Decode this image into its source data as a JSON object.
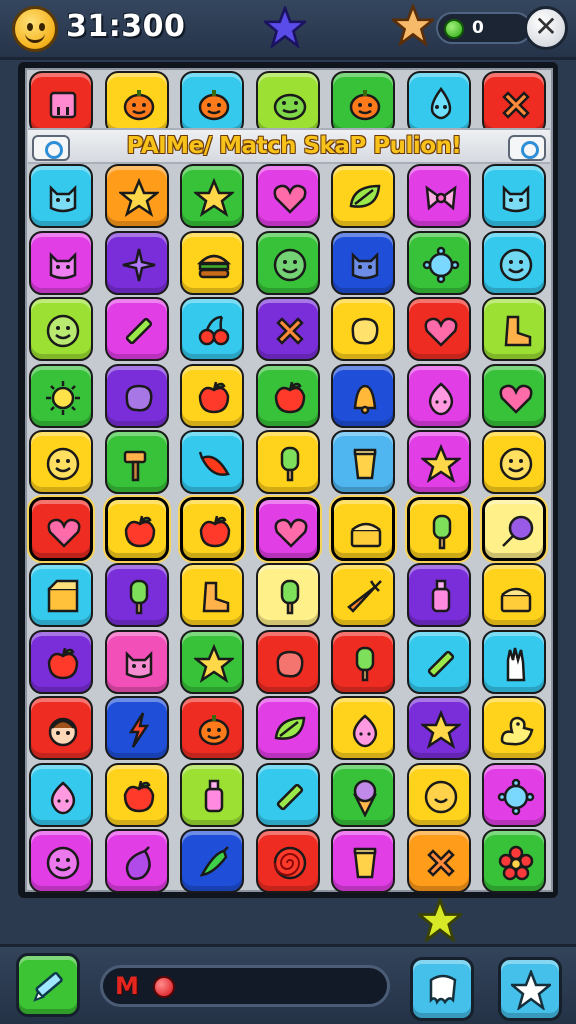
{
  "hud": {
    "score": "31:300",
    "coins": "0",
    "close_symbol": "✕"
  },
  "banner": {
    "title": "PAIMe/ Match SkaP Pulion!"
  },
  "progress": {
    "label": "M",
    "fraction": 0.0
  },
  "colors": {
    "red": "#ee2c22",
    "yellow": "#ffd21c",
    "cyan": "#35c9ee",
    "lime": "#9be033",
    "green": "#38c23a",
    "magenta": "#e23ee6",
    "purple": "#7a2ed9",
    "orange": "#ff9c1a",
    "blue": "#1f4fd8",
    "sky": "#4fb6f0",
    "pink": "#f24fb8",
    "paleyellow": "#fff08a"
  },
  "board": {
    "columns": 7,
    "rows": [
      [
        {
          "c": "red",
          "i": "robot"
        },
        {
          "c": "yellow",
          "i": "pumpkin"
        },
        {
          "c": "cyan",
          "i": "pumpkin"
        },
        {
          "c": "lime",
          "i": "frog"
        },
        {
          "c": "green",
          "i": "pumpkin"
        },
        {
          "c": "cyan",
          "i": "drop"
        },
        {
          "c": "red",
          "i": "x-cross"
        }
      ],
      [
        {
          "c": "cyan",
          "i": "cat"
        },
        {
          "c": "orange",
          "i": "star"
        },
        {
          "c": "green",
          "i": "star"
        },
        {
          "c": "magenta",
          "i": "heart"
        },
        {
          "c": "yellow",
          "i": "leaf"
        },
        {
          "c": "magenta",
          "i": "bow"
        },
        {
          "c": "cyan",
          "i": "cat"
        }
      ],
      [
        {
          "c": "magenta",
          "i": "cat"
        },
        {
          "c": "purple",
          "i": "sparkle"
        },
        {
          "c": "yellow",
          "i": "burger"
        },
        {
          "c": "green",
          "i": "smiley"
        },
        {
          "c": "blue",
          "i": "cat"
        },
        {
          "c": "green",
          "i": "germ"
        },
        {
          "c": "cyan",
          "i": "smiley"
        }
      ],
      [
        {
          "c": "lime",
          "i": "smiley"
        },
        {
          "c": "magenta",
          "i": "pencil"
        },
        {
          "c": "cyan",
          "i": "cherry"
        },
        {
          "c": "purple",
          "i": "x-cross"
        },
        {
          "c": "yellow",
          "i": "blob"
        },
        {
          "c": "red",
          "i": "heart"
        },
        {
          "c": "lime",
          "i": "boot"
        }
      ],
      [
        {
          "c": "green",
          "i": "sun"
        },
        {
          "c": "purple",
          "i": "blob"
        },
        {
          "c": "yellow",
          "i": "apple"
        },
        {
          "c": "green",
          "i": "apple"
        },
        {
          "c": "blue",
          "i": "bell"
        },
        {
          "c": "magenta",
          "i": "onion"
        },
        {
          "c": "green",
          "i": "heart"
        }
      ],
      [
        {
          "c": "yellow",
          "i": "smiley"
        },
        {
          "c": "green",
          "i": "hammer"
        },
        {
          "c": "cyan",
          "i": "chili"
        },
        {
          "c": "yellow",
          "i": "popsicle"
        },
        {
          "c": "sky",
          "i": "cup"
        },
        {
          "c": "magenta",
          "i": "star"
        },
        {
          "c": "yellow",
          "i": "smiley"
        }
      ],
      [
        {
          "c": "red",
          "i": "heart",
          "h": true
        },
        {
          "c": "yellow",
          "i": "apple",
          "h": true
        },
        {
          "c": "yellow",
          "i": "apple",
          "h": true
        },
        {
          "c": "magenta",
          "i": "heart",
          "h": true
        },
        {
          "c": "yellow",
          "i": "cake",
          "h": true
        },
        {
          "c": "yellow",
          "i": "popsicle",
          "h": true
        },
        {
          "c": "paleyellow",
          "i": "lollipop",
          "h": true
        }
      ],
      [
        {
          "c": "cyan",
          "i": "box"
        },
        {
          "c": "purple",
          "i": "popsicle"
        },
        {
          "c": "yellow",
          "i": "boot"
        },
        {
          "c": "paleyellow",
          "i": "popsicle"
        },
        {
          "c": "yellow",
          "i": "carrot"
        },
        {
          "c": "purple",
          "i": "bottle"
        },
        {
          "c": "yellow",
          "i": "cake"
        }
      ],
      [
        {
          "c": "purple",
          "i": "apple"
        },
        {
          "c": "pink",
          "i": "cat"
        },
        {
          "c": "green",
          "i": "star"
        },
        {
          "c": "red",
          "i": "blob"
        },
        {
          "c": "red",
          "i": "popsicle"
        },
        {
          "c": "cyan",
          "i": "pencil"
        },
        {
          "c": "cyan",
          "i": "glove"
        }
      ],
      [
        {
          "c": "red",
          "i": "face"
        },
        {
          "c": "blue",
          "i": "bolt"
        },
        {
          "c": "red",
          "i": "pumpkin"
        },
        {
          "c": "magenta",
          "i": "leaf"
        },
        {
          "c": "yellow",
          "i": "onion"
        },
        {
          "c": "purple",
          "i": "star"
        },
        {
          "c": "yellow",
          "i": "duck"
        }
      ],
      [
        {
          "c": "cyan",
          "i": "onion"
        },
        {
          "c": "yellow",
          "i": "apple"
        },
        {
          "c": "lime",
          "i": "bottle"
        },
        {
          "c": "cyan",
          "i": "pencil"
        },
        {
          "c": "green",
          "i": "icecream"
        },
        {
          "c": "yellow",
          "i": "coin"
        },
        {
          "c": "magenta",
          "i": "germ"
        }
      ],
      [
        {
          "c": "magenta",
          "i": "smiley"
        },
        {
          "c": "magenta",
          "i": "eggplant"
        },
        {
          "c": "blue",
          "i": "pepper"
        },
        {
          "c": "red",
          "i": "spiral"
        },
        {
          "c": "magenta",
          "i": "cup"
        },
        {
          "c": "orange",
          "i": "x-cross"
        },
        {
          "c": "green",
          "i": "flower"
        }
      ]
    ]
  },
  "icons": {
    "top_star": "star-icon",
    "coin_star": "star-icon",
    "float_star": "star-icon",
    "pencil_button": "pencil-icon",
    "hint_button": "ghost-icon",
    "star_button": "star-icon"
  }
}
